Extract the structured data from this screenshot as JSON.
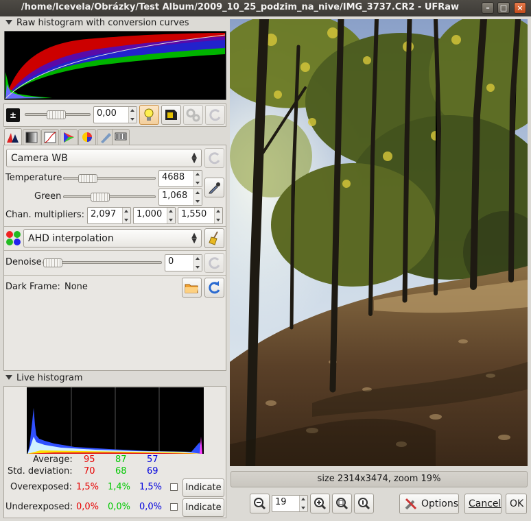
{
  "window": {
    "title": "/home/lcevela/Obrázky/Test Album/2009_10_25_podzim_na_nive/IMG_3737.CR2 - UFRaw"
  },
  "raw_histogram": {
    "label": "Raw histogram with conversion curves"
  },
  "exposure": {
    "value": "0,00"
  },
  "wb": {
    "preset": "Camera WB",
    "temperature_label": "Temperature",
    "temperature": "4688",
    "green_label": "Green",
    "green": "1,068",
    "chan_label": "Chan. multipliers:",
    "chan_r": "2,097",
    "chan_g": "1,000",
    "chan_b": "1,550"
  },
  "interpolation": {
    "value": "AHD interpolation"
  },
  "denoise": {
    "label": "Denoise",
    "value": "0"
  },
  "dark_frame": {
    "label": "Dark Frame:",
    "value": "None"
  },
  "live_histogram": {
    "label": "Live histogram",
    "average_label": "Average:",
    "avg_r": "95",
    "avg_g": "87",
    "avg_b": "57",
    "std_label": "Std. deviation:",
    "std_r": "70",
    "std_g": "68",
    "std_b": "69",
    "over_label": "Overexposed:",
    "over_r": "1,5%",
    "over_g": "1,4%",
    "over_b": "1,5%",
    "under_label": "Underexposed:",
    "under_r": "0,0%",
    "under_g": "0,0%",
    "under_b": "0,0%",
    "indicate": "Indicate"
  },
  "preview": {
    "status": "size 2314x3474, zoom 19%"
  },
  "zoom": {
    "value": "19"
  },
  "buttons": {
    "options": "Options",
    "cancel": "Cancel",
    "ok": "OK"
  },
  "colors": {
    "red": "#e60000",
    "green": "#00c800",
    "blue": "#0000dd"
  }
}
